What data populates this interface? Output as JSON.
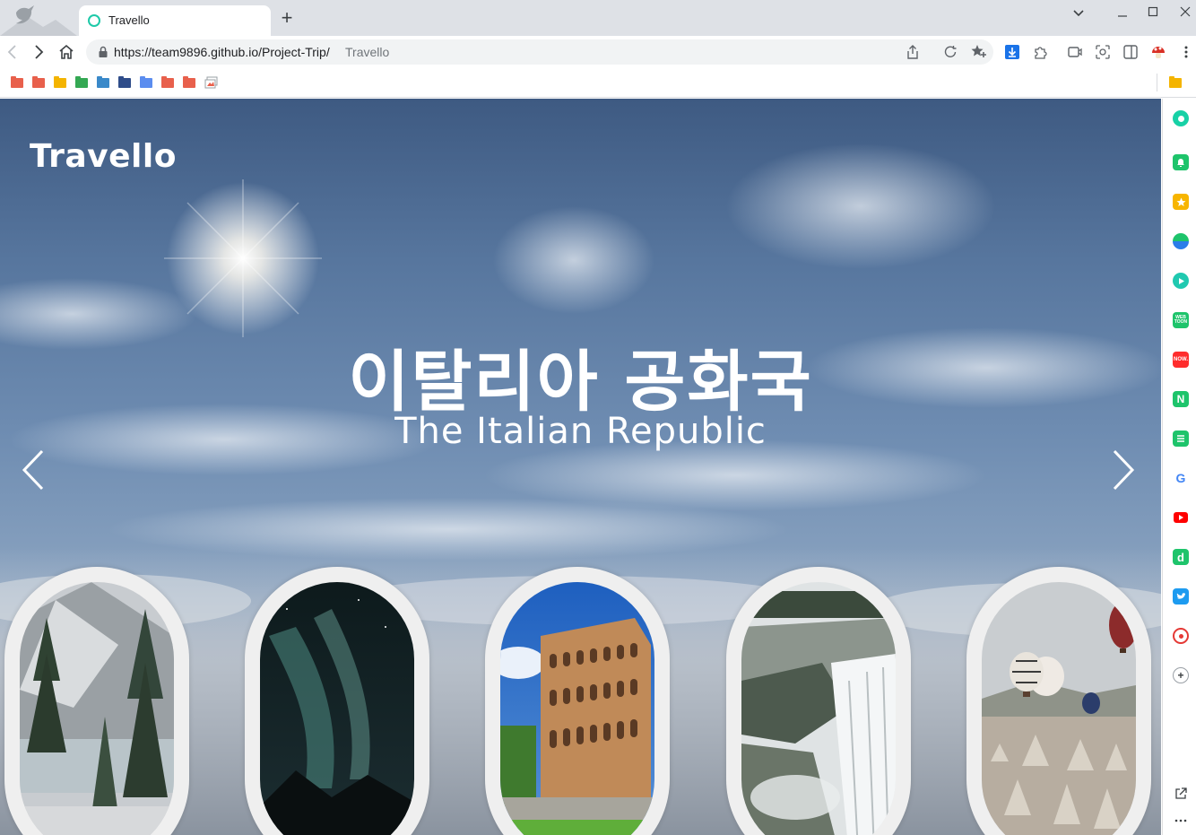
{
  "browser": {
    "tab_title": "Travello",
    "url": "https://team9896.github.io/Project-Trip/",
    "page_title_hint": "Travello",
    "bookmark_colors": [
      "#e8604c",
      "#e8604c",
      "#f4b400",
      "#34a853",
      "#4285f4",
      "#2f4d8a",
      "#5b8def",
      "#e8604c",
      "#e8604c"
    ]
  },
  "page": {
    "logo": "Travello",
    "hero_title": "이탈리아 공화국",
    "hero_subtitle": "The Italian Republic",
    "cards": [
      {
        "name": "snowy-forest-lake",
        "icon": "pine-forest-image"
      },
      {
        "name": "aurora-night",
        "icon": "aurora-image"
      },
      {
        "name": "colosseum",
        "icon": "colosseum-image"
      },
      {
        "name": "waterfall",
        "icon": "waterfall-image"
      },
      {
        "name": "hot-air-balloons",
        "icon": "balloon-image"
      }
    ]
  },
  "side_panel": {
    "icons": [
      "naver-whale-icon",
      "bell-icon",
      "star-icon",
      "edge-icon",
      "play-icon",
      "webtoon-icon",
      "now-icon",
      "naver-icon",
      "sheets-icon",
      "google-icon",
      "youtube-icon",
      "d-icon",
      "twitter-icon",
      "record-icon",
      "add-icon"
    ],
    "labels": {
      "webtoon": "WEB TOON",
      "now": "NOW.",
      "naver": "N",
      "d": "d",
      "google": "G"
    }
  }
}
